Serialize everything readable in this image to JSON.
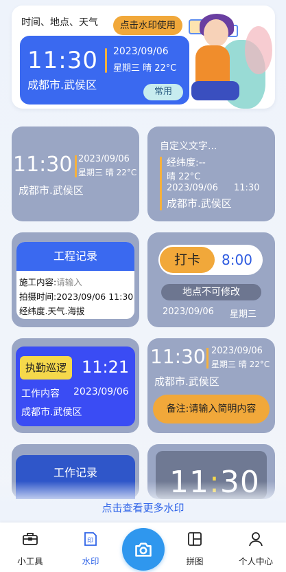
{
  "hero": {
    "title": "时间、地点、天气",
    "badge": "点击水印使用",
    "time": "11:30",
    "date": "2023/09/06",
    "weekday_weather": "星期三  晴  22°C",
    "location": "成都市.武侯区",
    "common_label": "常用"
  },
  "cards": {
    "c1": {
      "time": "11:30",
      "date": "2023/09/06",
      "week": "星期三 晴 22°C",
      "location": "成都市.武侯区"
    },
    "c2": {
      "custom": "自定义文字...",
      "coords": "经纬度:--",
      "weather": "晴   22°C",
      "date": "2023/09/06",
      "time": "11:30",
      "location": "成都市.武侯区"
    },
    "c3": {
      "header": "工程记录",
      "content_label": "施工内容:",
      "content_placeholder": "请输入",
      "shot_time": "拍摄时间:2023/09/06 11:30",
      "coords": "经纬度.天气.海拔"
    },
    "c4": {
      "punch": "打卡",
      "time": "8:00",
      "fixed": "地点不可修改",
      "date": "2023/09/06",
      "week": "星期三"
    },
    "c5": {
      "tag": "执勤巡逻",
      "time": "11:21",
      "work": "工作内容",
      "date": "2023/09/06",
      "location": "成都市.武侯区"
    },
    "c6": {
      "time": "11:30",
      "date": "2023/09/06",
      "week": "星期三 晴 22°C",
      "location": "成都市.武侯区",
      "note": "备注:请输入简明内容"
    },
    "c7": {
      "title": "工作记录"
    },
    "c8": {
      "hour": "11",
      "colon": ":",
      "minute": "30"
    }
  },
  "more_link": "点击查看更多水印",
  "tabbar": {
    "tools": "小工具",
    "watermark": "水印",
    "collage": "拼图",
    "profile": "个人中心",
    "active": "watermark",
    "accent": "#2f64e8"
  }
}
